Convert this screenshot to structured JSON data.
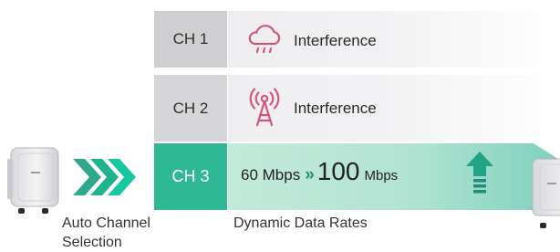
{
  "channels": [
    {
      "label": "CH 1",
      "status": "Interference",
      "icon": "cloud-rain-icon"
    },
    {
      "label": "CH 2",
      "status": "Interference",
      "icon": "radio-tower-icon"
    },
    {
      "label": "CH 3",
      "icon": "none"
    }
  ],
  "rate": {
    "from_value": "60 Mbps",
    "arrow": "»",
    "to_value": "100",
    "to_unit": "Mbps",
    "increase_icon": "up-arrow-icon"
  },
  "captions": {
    "left": "Auto Channel Selection",
    "middle": "Dynamic Data Rates"
  },
  "colors": {
    "active_channel": "#2eb894",
    "interference_icon": "#d4567d",
    "accent_teal": "#1fa486",
    "chevrons": "#1fb38e"
  }
}
